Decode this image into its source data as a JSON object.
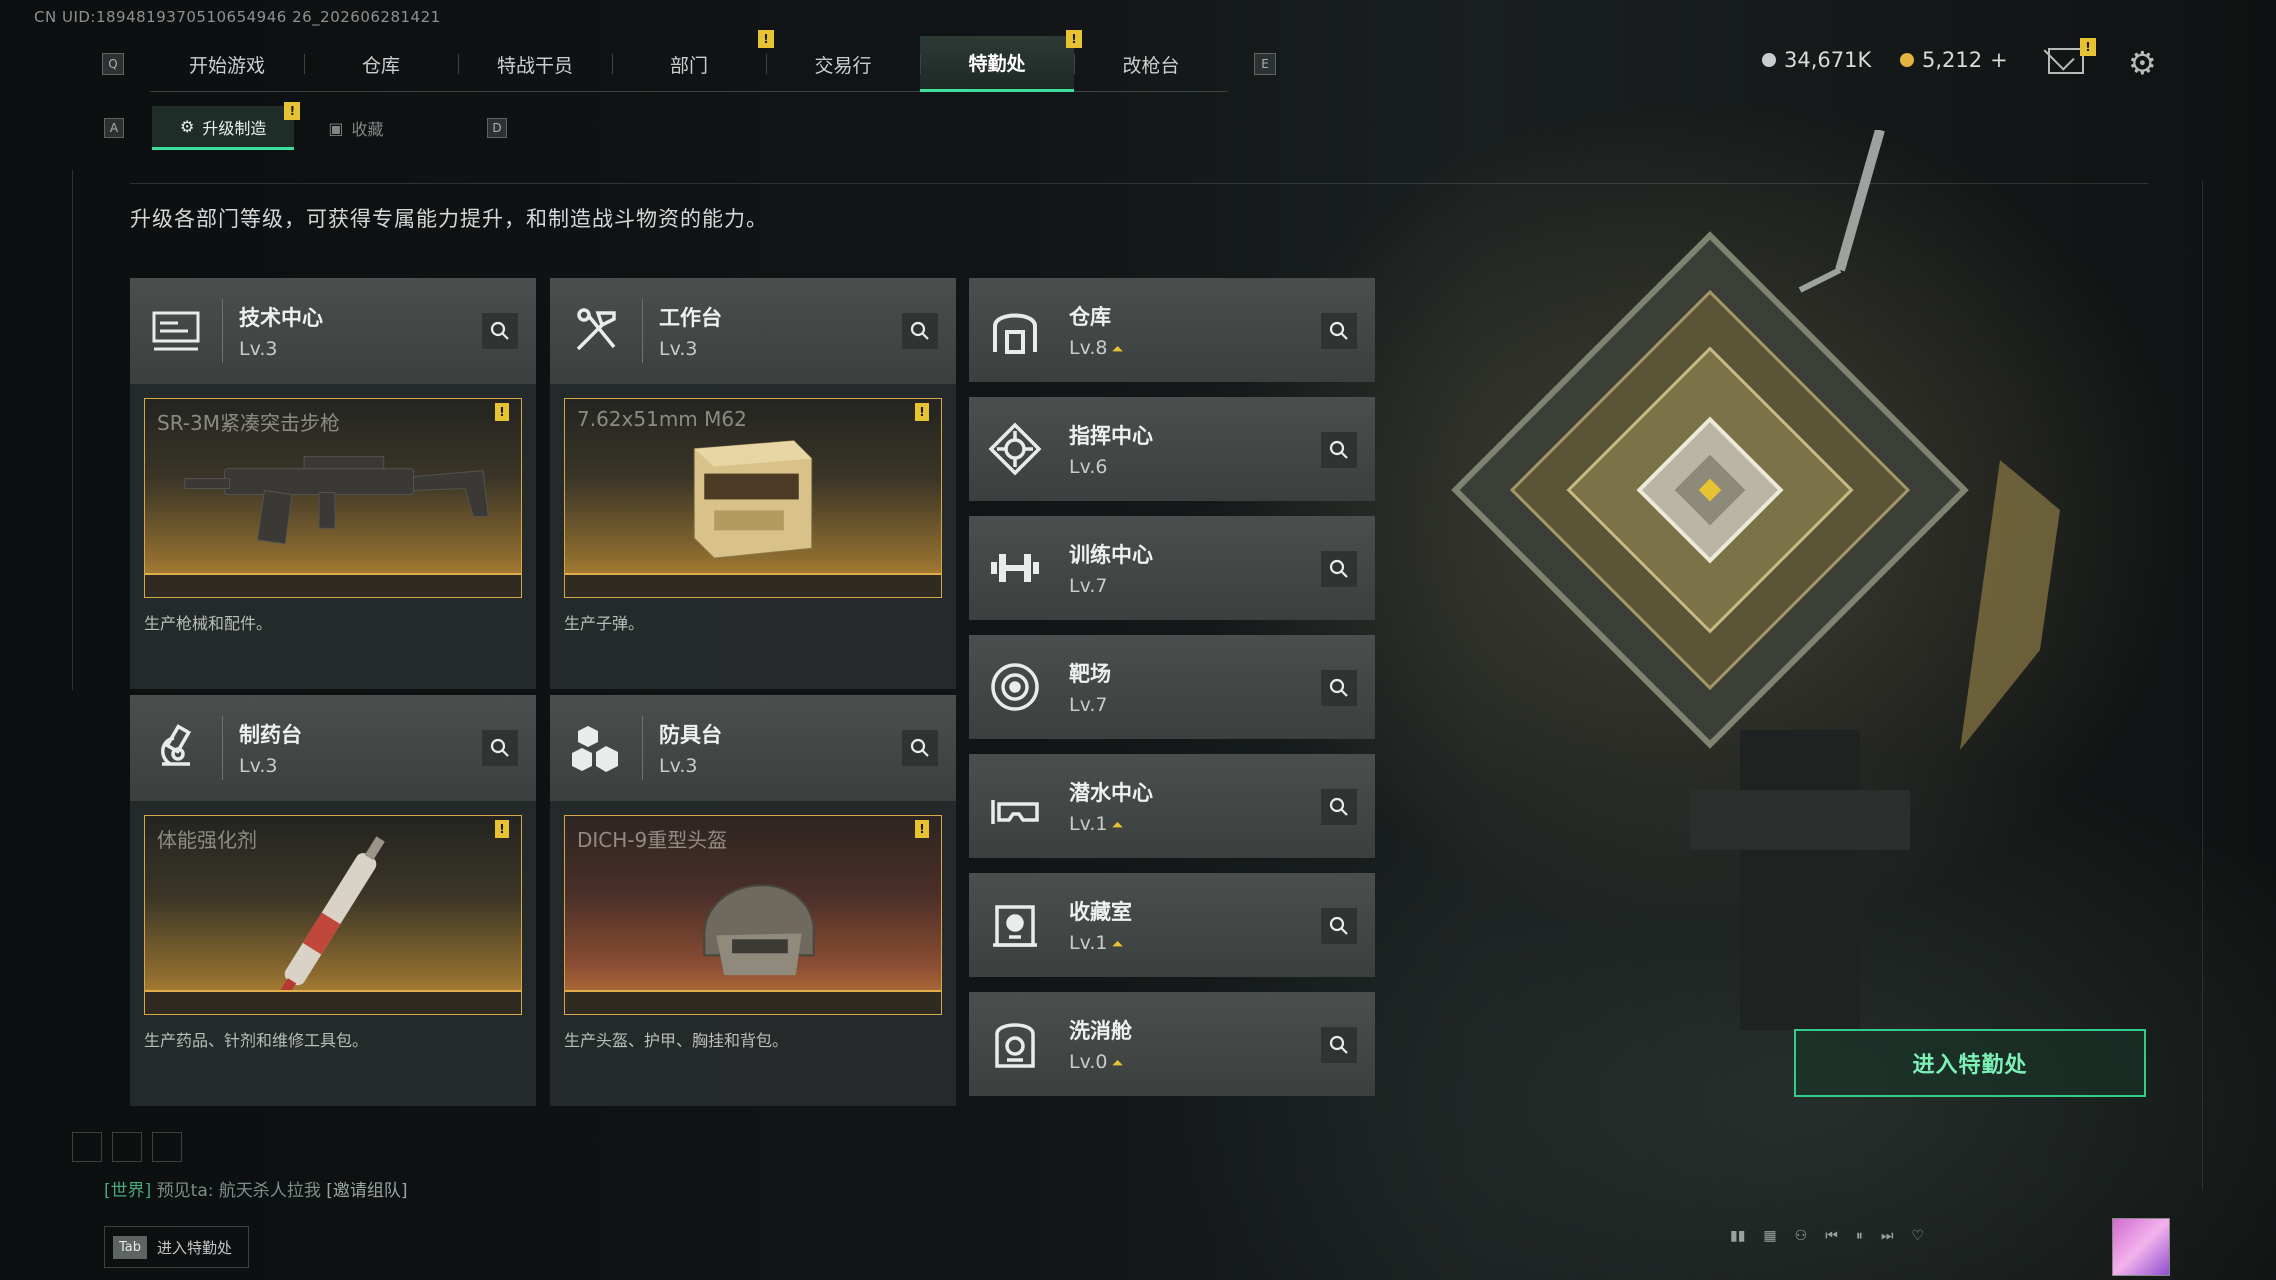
{
  "uid": "CN UID:1894819370510654946 26_202606281421",
  "hotkeys": {
    "left": "Q",
    "right": "E",
    "sub_left": "A",
    "sub_right": "D"
  },
  "nav": {
    "tabs": [
      {
        "label": "开始游戏",
        "badge": ""
      },
      {
        "label": "仓库",
        "badge": ""
      },
      {
        "label": "特战干员",
        "badge": ""
      },
      {
        "label": "部门",
        "badge": "!"
      },
      {
        "label": "交易行",
        "badge": ""
      },
      {
        "label": "特勤处",
        "badge": "!",
        "active": true
      },
      {
        "label": "改枪台",
        "badge": ""
      }
    ]
  },
  "currency": {
    "silver": "34,671K",
    "gold": "5,212",
    "gold_add": "+",
    "silver_color": "#c9cdd0",
    "gold_color": "#e3b440"
  },
  "mail_badge": "!",
  "subtabs": [
    {
      "label": "升级制造",
      "icon": "upgrade-icon",
      "active": true,
      "badge": "!"
    },
    {
      "label": "收藏",
      "icon": "collection-icon",
      "active": false
    }
  ],
  "description": "升级各部门等级，可获得专属能力提升，和制造战斗物资的能力。",
  "main_depts": [
    {
      "name": "技术中心",
      "level": "Lv.3",
      "icon": "tech-center-icon",
      "craft_title": "SR-3M紧凑突击步枪",
      "craft_desc": "生产枪械和配件。",
      "badge": "!"
    },
    {
      "name": "工作台",
      "level": "Lv.3",
      "icon": "workbench-icon",
      "craft_title": "7.62x51mm M62",
      "craft_desc": "生产子弹。",
      "badge": "!"
    },
    {
      "name": "制药台",
      "level": "Lv.3",
      "icon": "pharmacy-icon",
      "craft_title": "体能强化剂",
      "craft_desc": "生产药品、针剂和维修工具包。",
      "badge": "!"
    },
    {
      "name": "防具台",
      "level": "Lv.3",
      "icon": "armor-bench-icon",
      "craft_title": "DICH-9重型头盔",
      "craft_desc": "生产头盔、护甲、胸挂和背包。",
      "badge": "!"
    }
  ],
  "side_depts": [
    {
      "name": "仓库",
      "level": "Lv.8",
      "upgrade": true,
      "icon": "warehouse-icon"
    },
    {
      "name": "指挥中心",
      "level": "Lv.6",
      "upgrade": false,
      "icon": "command-center-icon"
    },
    {
      "name": "训练中心",
      "level": "Lv.7",
      "upgrade": false,
      "icon": "training-center-icon"
    },
    {
      "name": "靶场",
      "level": "Lv.7",
      "upgrade": false,
      "icon": "shooting-range-icon"
    },
    {
      "name": "潜水中心",
      "level": "Lv.1",
      "upgrade": true,
      "icon": "diving-center-icon"
    },
    {
      "name": "收藏室",
      "level": "Lv.1",
      "upgrade": true,
      "icon": "collection-room-icon"
    },
    {
      "name": "洗消舱",
      "level": "Lv.0",
      "upgrade": true,
      "icon": "decon-chamber-icon"
    }
  ],
  "enter_button": "进入特勤处",
  "chat": {
    "channel": "[世界]",
    "sender": "预见ta:",
    "message": "航天杀人拉我",
    "invite": "[邀请组队]"
  },
  "tab_hint": {
    "key": "Tab",
    "label": "进入特勤处"
  },
  "accent": "#3ddf9b"
}
